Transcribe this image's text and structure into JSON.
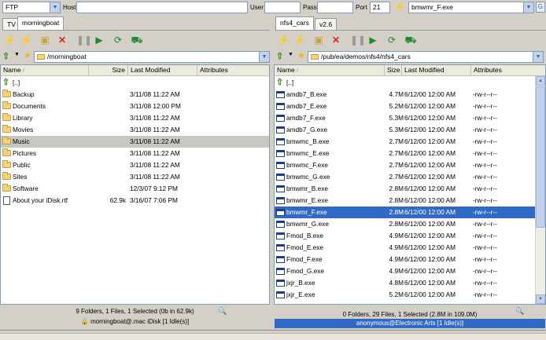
{
  "connection_bar": {
    "protocol": "FTP",
    "host_label": "Host",
    "host_value": "",
    "user_label": "User",
    "user_value": "",
    "pass_label": "Pass",
    "pass_value": "",
    "port_label": "Port",
    "port_value": "21",
    "quick_file": "bmwmr_F.exe"
  },
  "left": {
    "tabs": [
      "TV",
      "morningboat"
    ],
    "path": "/morningboat",
    "columns": [
      "Name",
      "Size",
      "Last Modified",
      "Attributes"
    ],
    "rows": [
      {
        "name": "[..]",
        "size": "",
        "modified": "",
        "attr": "",
        "icon": "up-icon"
      },
      {
        "name": "Backup",
        "size": "",
        "modified": "3/11/08 11:22 AM",
        "attr": "",
        "icon": "folder-icon"
      },
      {
        "name": "Documents",
        "size": "",
        "modified": "3/11/08 12:00 PM",
        "attr": "",
        "icon": "folder-icon"
      },
      {
        "name": "Library",
        "size": "",
        "modified": "3/11/08 11:22 AM",
        "attr": "",
        "icon": "folder-icon"
      },
      {
        "name": "Movies",
        "size": "",
        "modified": "3/11/08 11:22 AM",
        "attr": "",
        "icon": "folder-icon"
      },
      {
        "name": "Music",
        "size": "",
        "modified": "3/11/08 11:22 AM",
        "attr": "",
        "icon": "folder-icon"
      },
      {
        "name": "Pictures",
        "size": "",
        "modified": "3/11/08 11:22 AM",
        "attr": "",
        "icon": "folder-icon"
      },
      {
        "name": "Public",
        "size": "",
        "modified": "3/11/08 11:22 AM",
        "attr": "",
        "icon": "folder-icon"
      },
      {
        "name": "Sites",
        "size": "",
        "modified": "3/11/08 11:22 AM",
        "attr": "",
        "icon": "folder-icon"
      },
      {
        "name": "Software",
        "size": "",
        "modified": "12/3/07 9:12 PM",
        "attr": "",
        "icon": "folder-icon"
      },
      {
        "name": "About your iDisk.rtf",
        "size": "62.9k",
        "modified": "3/16/07 7:06 PM",
        "attr": "",
        "icon": "file-icon"
      }
    ],
    "status_summary": "9 Folders, 1 Files, 1 Selected (0b in 62.9k)",
    "status_connection": "morningboat@.mac iDisk [1 Idle(s)]"
  },
  "right": {
    "tabs": [
      "nfs4_cars",
      "v2.6"
    ],
    "path": "/pub/ea/demos/nfs4/nfs4_cars",
    "columns": [
      "Name",
      "Size",
      "Last Modified",
      "Attributes"
    ],
    "rows": [
      {
        "name": "[..]",
        "size": "",
        "modified": "",
        "attr": "",
        "icon": "up-icon"
      },
      {
        "name": "amdb7_B.exe",
        "size": "4.7M",
        "modified": "6/12/00 12:00 AM",
        "attr": "-rw-r--r--",
        "icon": "exe-icon"
      },
      {
        "name": "amdb7_E.exe",
        "size": "5.2M",
        "modified": "6/12/00 12:00 AM",
        "attr": "-rw-r--r--",
        "icon": "exe-icon"
      },
      {
        "name": "amdb7_F.exe",
        "size": "5.3M",
        "modified": "6/12/00 12:00 AM",
        "attr": "-rw-r--r--",
        "icon": "exe-icon"
      },
      {
        "name": "amdb7_G.exe",
        "size": "5.3M",
        "modified": "6/12/00 12:00 AM",
        "attr": "-rw-r--r--",
        "icon": "exe-icon"
      },
      {
        "name": "bmwmc_B.exe",
        "size": "2.7M",
        "modified": "6/12/00 12:00 AM",
        "attr": "-rw-r--r--",
        "icon": "exe-icon"
      },
      {
        "name": "bmwmc_E.exe",
        "size": "2.7M",
        "modified": "6/12/00 12:00 AM",
        "attr": "-rw-r--r--",
        "icon": "exe-icon"
      },
      {
        "name": "bmwmc_F.exe",
        "size": "2.7M",
        "modified": "6/12/00 12:00 AM",
        "attr": "-rw-r--r--",
        "icon": "exe-icon"
      },
      {
        "name": "bmwmc_G.exe",
        "size": "2.7M",
        "modified": "6/12/00 12:00 AM",
        "attr": "-rw-r--r--",
        "icon": "exe-icon"
      },
      {
        "name": "bmwmr_B.exe",
        "size": "2.8M",
        "modified": "6/12/00 12:00 AM",
        "attr": "-rw-r--r--",
        "icon": "exe-icon"
      },
      {
        "name": "bmwmr_E.exe",
        "size": "2.8M",
        "modified": "6/12/00 12:00 AM",
        "attr": "-rw-r--r--",
        "icon": "exe-icon"
      },
      {
        "name": "bmwmr_F.exe",
        "size": "2.8M",
        "modified": "6/12/00 12:00 AM",
        "attr": "-rw-r--r--",
        "icon": "exe-icon"
      },
      {
        "name": "bmwmr_G.exe",
        "size": "2.8M",
        "modified": "6/12/00 12:00 AM",
        "attr": "-rw-r--r--",
        "icon": "exe-icon"
      },
      {
        "name": "Fmod_B.exe",
        "size": "4.9M",
        "modified": "6/12/00 12:00 AM",
        "attr": "-rw-r--r--",
        "icon": "exe-icon"
      },
      {
        "name": "Fmod_E.exe",
        "size": "4.9M",
        "modified": "6/12/00 12:00 AM",
        "attr": "-rw-r--r--",
        "icon": "exe-icon"
      },
      {
        "name": "Fmod_F.exe",
        "size": "4.9M",
        "modified": "6/12/00 12:00 AM",
        "attr": "-rw-r--r--",
        "icon": "exe-icon"
      },
      {
        "name": "Fmod_G.exe",
        "size": "4.9M",
        "modified": "6/12/00 12:00 AM",
        "attr": "-rw-r--r--",
        "icon": "exe-icon"
      },
      {
        "name": "jxjr_B.exe",
        "size": "4.8M",
        "modified": "6/12/00 12:00 AM",
        "attr": "-rw-r--r--",
        "icon": "exe-icon"
      },
      {
        "name": "jxjr_E.exe",
        "size": "5.2M",
        "modified": "6/12/00 12:00 AM",
        "attr": "-rw-r--r--",
        "icon": "exe-icon"
      }
    ],
    "status_summary": "0 Folders, 29 Files, 1 Selected (2.8M in 109.0M)",
    "status_connection": "anonymous@Electronic Arts [1 Idle(s)]"
  },
  "colors": {
    "selection_blue": "#316ac5",
    "selection_gray": "#c9c7c1",
    "delete_red": "#d9261c",
    "go_green": "#1e8c2a"
  }
}
